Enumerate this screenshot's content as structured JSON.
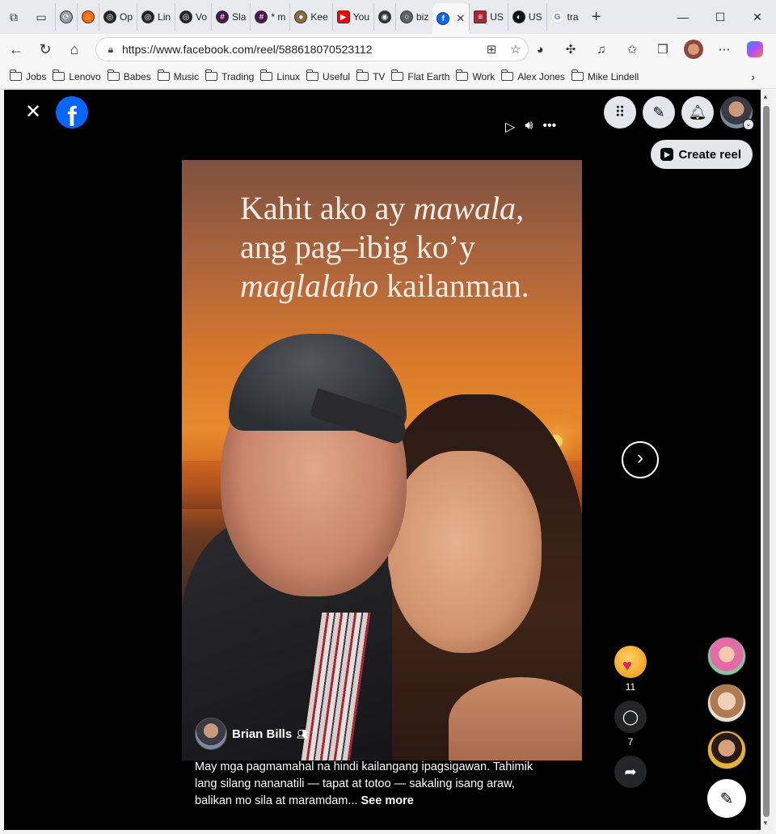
{
  "browser": {
    "tabs": [
      {
        "label": "",
        "icon": "loading-icon",
        "color": "#9aa0a6"
      },
      {
        "label": "",
        "icon": "fire-icon",
        "color": "#ff6a00"
      },
      {
        "label": "Op",
        "icon": "openai-icon",
        "color": "#222222"
      },
      {
        "label": "Lin",
        "icon": "openai-icon",
        "color": "#222222"
      },
      {
        "label": "Vo",
        "icon": "openai-icon",
        "color": "#222222"
      },
      {
        "label": "Sla",
        "icon": "slack-icon",
        "color": "#4a154b"
      },
      {
        "label": "* m",
        "icon": "slack-icon",
        "color": "#4a154b"
      },
      {
        "label": "Kee",
        "icon": "globe-icon",
        "color": "#8a6d3b"
      },
      {
        "label": "You",
        "icon": "youtube-icon",
        "color": "#ff0000"
      },
      {
        "label": "",
        "icon": "github-icon",
        "color": "#333333"
      },
      {
        "label": "biz",
        "icon": "globe-icon",
        "color": "#5f6368"
      },
      {
        "label": "",
        "icon": "facebook-icon",
        "color": "#0866ff",
        "active": true
      },
      {
        "label": "US",
        "icon": "flag-icon",
        "color": "#b22234"
      },
      {
        "label": "US",
        "icon": "chat-icon",
        "color": "#111111"
      },
      {
        "label": "tra",
        "icon": "google-icon",
        "color": "#4285f4"
      }
    ],
    "url": "https://www.facebook.com/reel/588618070523112",
    "bookmarks": [
      "Jobs",
      "Lenovo",
      "Babes",
      "Music",
      "Trading",
      "Linux",
      "Useful",
      "TV",
      "Flat Earth",
      "Work",
      "Alex Jones",
      "Mike Lindell"
    ]
  },
  "reel": {
    "quote": {
      "line1_a": "Kahit ako ay ",
      "line1_b": "mawala",
      "line1_c": ",",
      "line2": "ang pag–ibig ko’y",
      "line3_a": "maglalaho",
      "line3_b": " kailanman."
    },
    "author": "Brian Bills",
    "caption": "May mga pagmamahal na hindi kailangang ipagsigawan. Tahimik lang silang nananatili — tapat at totoo — sakaling isang araw, balikan mo sila at maramdam...",
    "see_more": "See more",
    "reaction_count": "11",
    "comment_count": "7"
  },
  "header": {
    "create_reel": "Create reel"
  },
  "colors": {
    "facebook_blue": "#0866ff",
    "page_bg": "#000000"
  }
}
